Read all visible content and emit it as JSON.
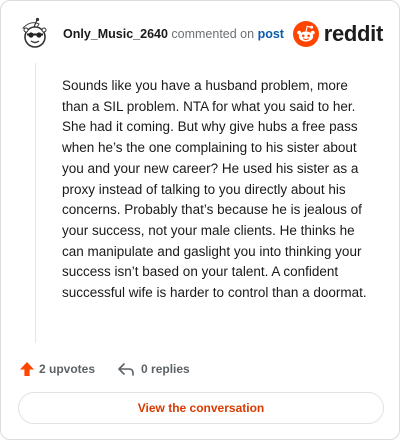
{
  "comment": {
    "author": "Only_Music_2640",
    "action_text": "commented on",
    "link_text": "post",
    "body": "Sounds like you have a husband problem, more than a SIL problem. NTA for what you said to her. She had it coming. But why give hubs a free pass when he’s the one complaining to his sister about you and your new career? He used his sister as a proxy instead of talking to you directly about his concerns. Probably that’s because he is jealous of your success, not your male clients. He thinks he can manipulate and gaslight you into thinking your success isn’t based on your talent. A confident successful wife is harder to control than a doormat."
  },
  "brand": {
    "name": "reddit",
    "accent": "#ff4500"
  },
  "stats": {
    "upvotes_label": "2 upvotes",
    "replies_label": "0 replies"
  },
  "cta": {
    "label": "View the conversation"
  },
  "icons": {
    "avatar": "snoo-avatar",
    "brand": "reddit-logo-icon",
    "upvote": "upvote-arrow-icon",
    "reply": "reply-arrow-icon"
  },
  "colors": {
    "upvote": "#ff4500",
    "link": "#0b5cad",
    "cta_text": "#d93a00",
    "muted": "#5c6266"
  }
}
